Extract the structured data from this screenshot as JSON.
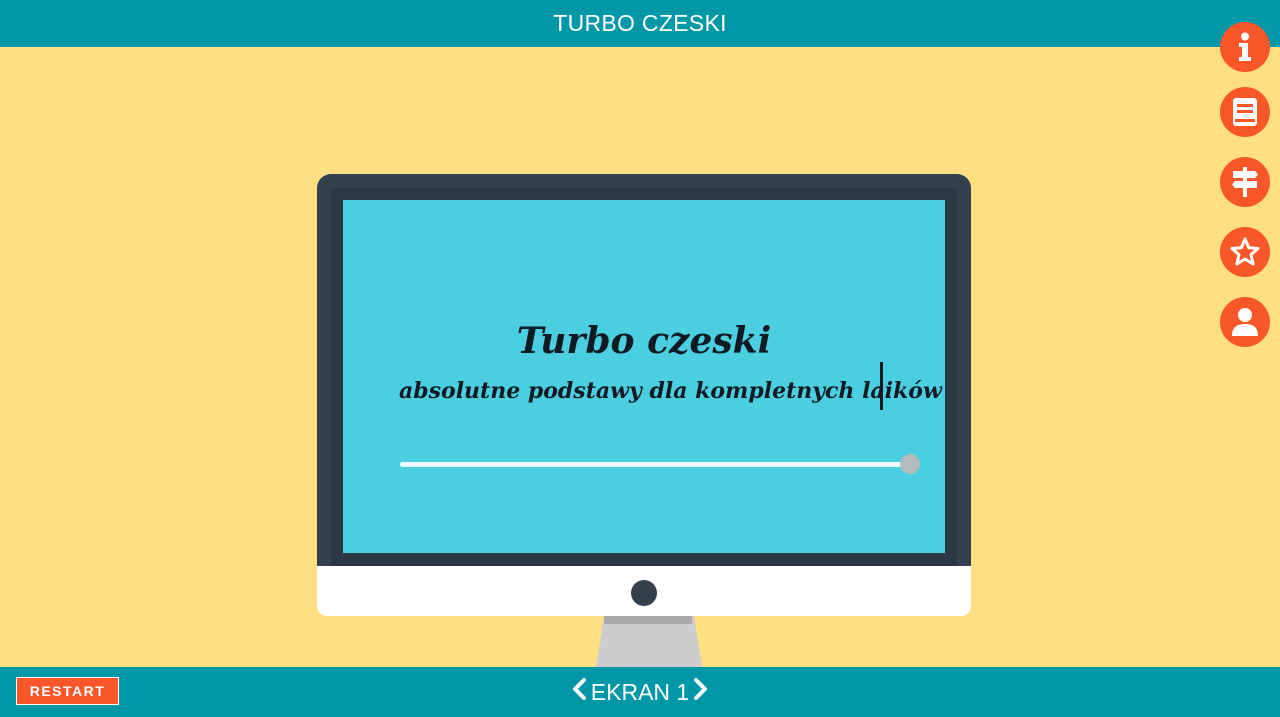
{
  "header": {
    "title": "TURBO CZESKI"
  },
  "side_buttons": [
    {
      "icon": "info-icon"
    },
    {
      "icon": "book-icon"
    },
    {
      "icon": "signpost-icon"
    },
    {
      "icon": "star-icon"
    },
    {
      "icon": "user-icon"
    }
  ],
  "slide": {
    "title": "Turbo czeski",
    "subtitle": "absolutne podstawy dla kompletnych laików",
    "progress": 1.0
  },
  "footer": {
    "restart_label": "RESTART",
    "screen_label": "EKRAN 1"
  },
  "colors": {
    "accent": "#f9572a",
    "bar": "#0097a7",
    "background": "#ffdf82",
    "screen": "#4bcfe0"
  }
}
